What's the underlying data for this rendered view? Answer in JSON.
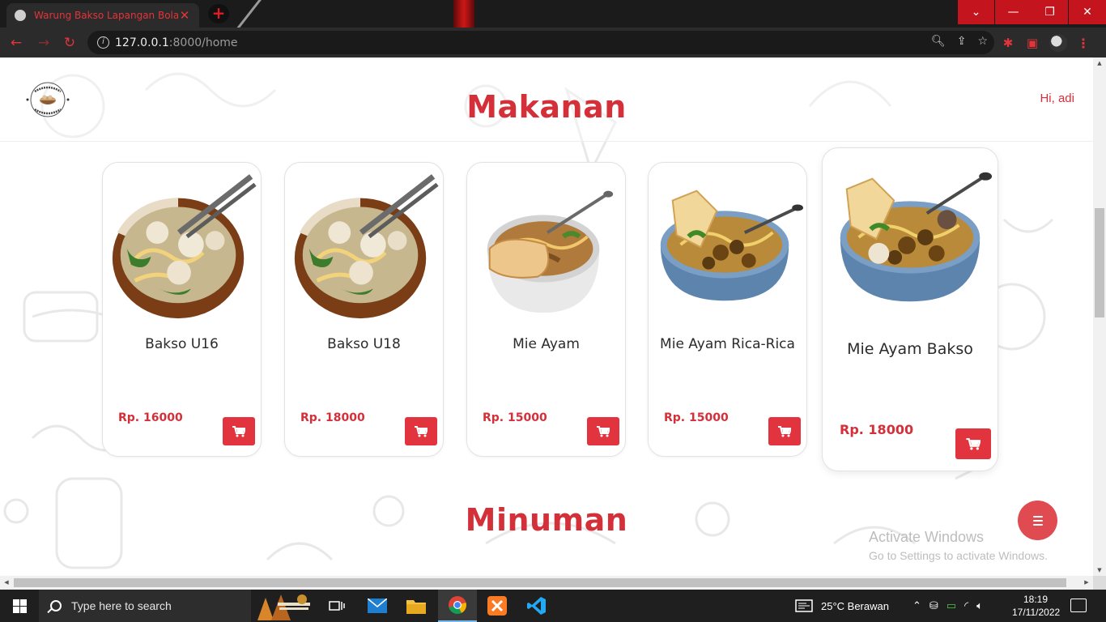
{
  "browser": {
    "tab_title": "Warung Bakso Lapangan Bola - H",
    "url_host": "127.0.0.1",
    "url_path": ":8000/home",
    "window_controls": [
      "chevron-down",
      "minimize",
      "restore",
      "close"
    ]
  },
  "header": {
    "logo_alt": "BAKSO MANTOL · BAKSO LAPANGAN BOLA",
    "greeting": "Hi, adi"
  },
  "sections": {
    "food_title": "Makanan",
    "drink_title": "Minuman"
  },
  "menu": [
    {
      "name": "Bakso U16",
      "price": "Rp. 16000",
      "dish": "bakso"
    },
    {
      "name": "Bakso U18",
      "price": "Rp. 18000",
      "dish": "bakso"
    },
    {
      "name": "Mie Ayam",
      "price": "Rp. 15000",
      "dish": "mie-ayam"
    },
    {
      "name": "Mie Ayam Rica-Rica",
      "price": "Rp. 15000",
      "dish": "mie-ayam-rica"
    },
    {
      "name": "Mie Ayam Bakso",
      "price": "Rp. 18000",
      "dish": "mie-ayam-bakso"
    }
  ],
  "watermark": {
    "title": "Activate Windows",
    "subtitle": "Go to Settings to activate Windows."
  },
  "taskbar": {
    "search_placeholder": "Type here to search",
    "weather": "25°C  Berawan",
    "time": "18:19",
    "date": "17/11/2022"
  },
  "colors": {
    "accent": "#d4303a",
    "cart_button": "#e1343e",
    "fab": "#e04b52"
  }
}
